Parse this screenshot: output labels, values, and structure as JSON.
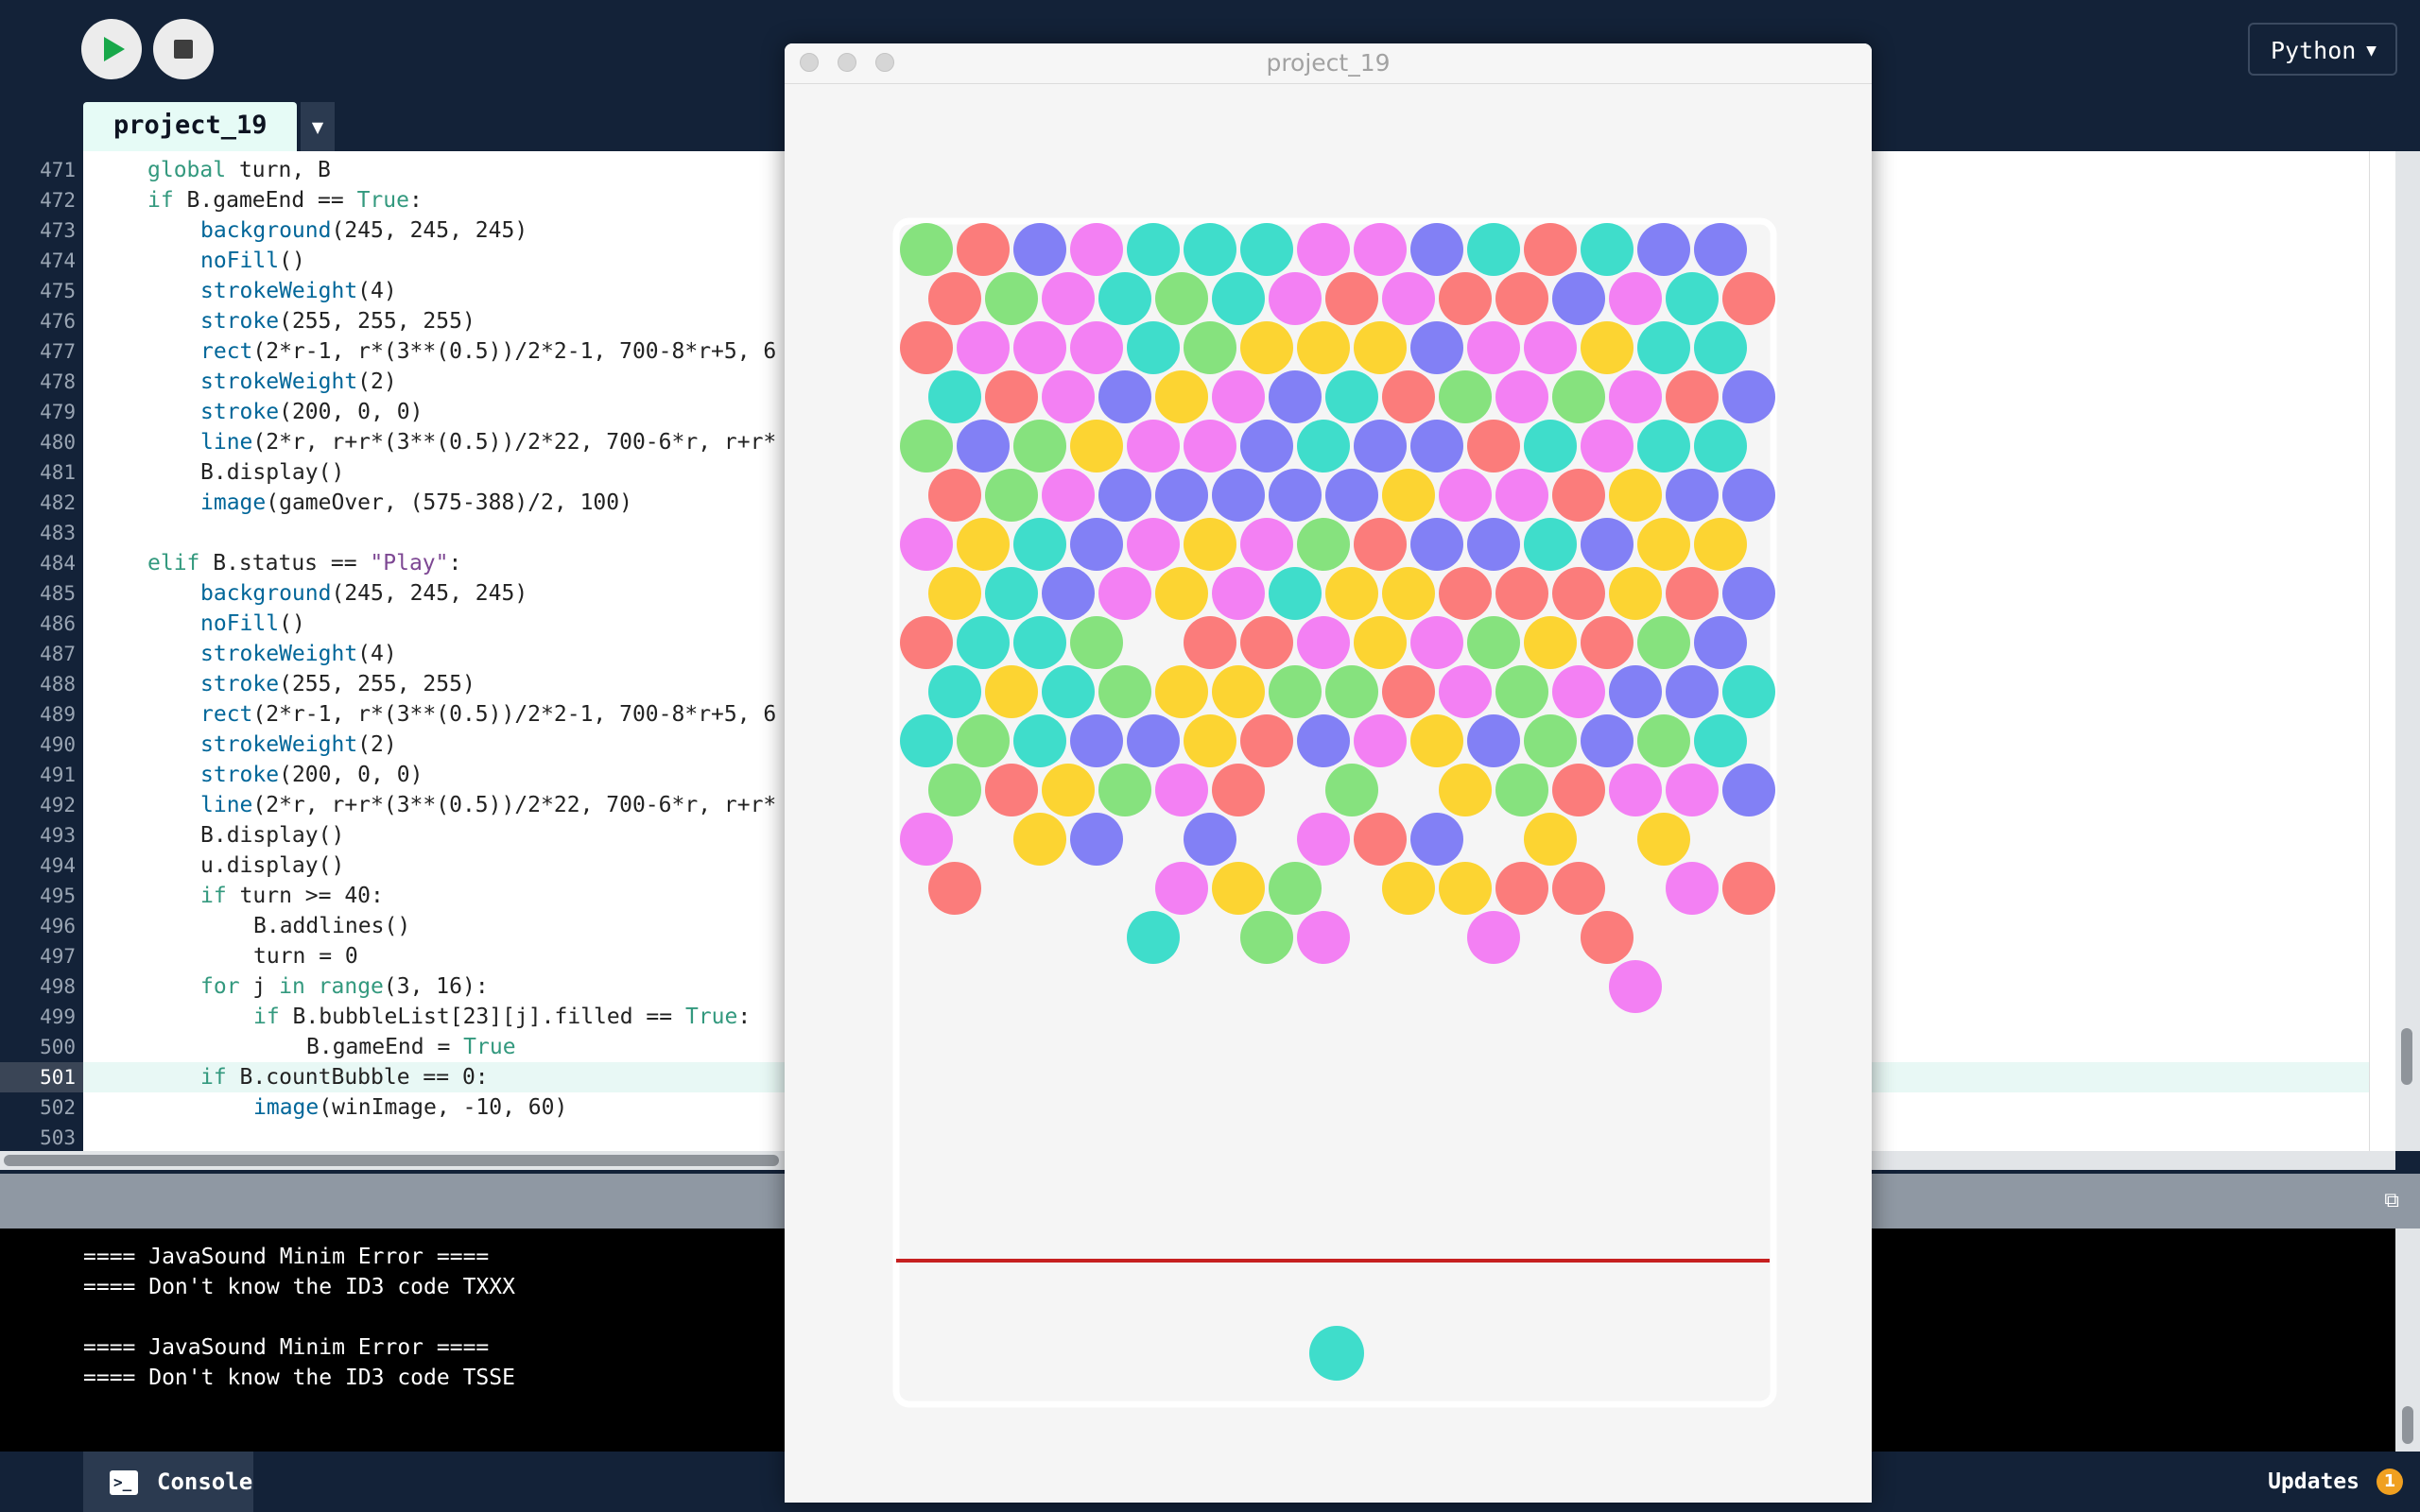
{
  "toolbar": {
    "run_icon": "play-icon",
    "stop_icon": "stop-icon",
    "mode": "Python",
    "mode_caret": "▼"
  },
  "tab": {
    "label": "project_19",
    "menu_caret": "▼"
  },
  "editor": {
    "current_line": "501",
    "lines": [
      {
        "num": "471",
        "indent": 1,
        "tokens": [
          {
            "t": "kw",
            "v": "global"
          },
          {
            "t": "",
            "v": " turn, B"
          }
        ]
      },
      {
        "num": "472",
        "indent": 1,
        "tokens": [
          {
            "t": "kw",
            "v": "if"
          },
          {
            "t": "",
            "v": " B.gameEnd == "
          },
          {
            "t": "kw",
            "v": "True"
          },
          {
            "t": "",
            "v": ":"
          }
        ]
      },
      {
        "num": "473",
        "indent": 2,
        "tokens": [
          {
            "t": "fn",
            "v": "background"
          },
          {
            "t": "",
            "v": "(245, 245, 245)"
          }
        ]
      },
      {
        "num": "474",
        "indent": 2,
        "tokens": [
          {
            "t": "fn",
            "v": "noFill"
          },
          {
            "t": "",
            "v": "()"
          }
        ]
      },
      {
        "num": "475",
        "indent": 2,
        "tokens": [
          {
            "t": "fn",
            "v": "strokeWeight"
          },
          {
            "t": "",
            "v": "(4)"
          }
        ]
      },
      {
        "num": "476",
        "indent": 2,
        "tokens": [
          {
            "t": "fn",
            "v": "stroke"
          },
          {
            "t": "",
            "v": "(255, 255, 255)"
          }
        ]
      },
      {
        "num": "477",
        "indent": 2,
        "tokens": [
          {
            "t": "fn",
            "v": "rect"
          },
          {
            "t": "",
            "v": "(2*r-1, r*(3**(0.5))/2*2-1, 700-8*r+5, 6"
          }
        ]
      },
      {
        "num": "478",
        "indent": 2,
        "tokens": [
          {
            "t": "fn",
            "v": "strokeWeight"
          },
          {
            "t": "",
            "v": "(2)"
          }
        ]
      },
      {
        "num": "479",
        "indent": 2,
        "tokens": [
          {
            "t": "fn",
            "v": "stroke"
          },
          {
            "t": "",
            "v": "(200, 0, 0)"
          }
        ]
      },
      {
        "num": "480",
        "indent": 2,
        "tokens": [
          {
            "t": "fn",
            "v": "line"
          },
          {
            "t": "",
            "v": "(2*r, r+r*(3**(0.5))/2*22, 700-6*r, r+r*"
          }
        ]
      },
      {
        "num": "481",
        "indent": 2,
        "tokens": [
          {
            "t": "",
            "v": "B.display()"
          }
        ]
      },
      {
        "num": "482",
        "indent": 2,
        "tokens": [
          {
            "t": "fn",
            "v": "image"
          },
          {
            "t": "",
            "v": "(gameOver, (575-388)/2, 100)"
          }
        ]
      },
      {
        "num": "483",
        "indent": 0,
        "tokens": []
      },
      {
        "num": "484",
        "indent": 1,
        "tokens": [
          {
            "t": "kw",
            "v": "elif"
          },
          {
            "t": "",
            "v": " B.status == "
          },
          {
            "t": "str",
            "v": "\"Play\""
          },
          {
            "t": "",
            "v": ":"
          }
        ]
      },
      {
        "num": "485",
        "indent": 2,
        "tokens": [
          {
            "t": "fn",
            "v": "background"
          },
          {
            "t": "",
            "v": "(245, 245, 245)"
          }
        ]
      },
      {
        "num": "486",
        "indent": 2,
        "tokens": [
          {
            "t": "fn",
            "v": "noFill"
          },
          {
            "t": "",
            "v": "()"
          }
        ]
      },
      {
        "num": "487",
        "indent": 2,
        "tokens": [
          {
            "t": "fn",
            "v": "strokeWeight"
          },
          {
            "t": "",
            "v": "(4)"
          }
        ]
      },
      {
        "num": "488",
        "indent": 2,
        "tokens": [
          {
            "t": "fn",
            "v": "stroke"
          },
          {
            "t": "",
            "v": "(255, 255, 255)"
          }
        ]
      },
      {
        "num": "489",
        "indent": 2,
        "tokens": [
          {
            "t": "fn",
            "v": "rect"
          },
          {
            "t": "",
            "v": "(2*r-1, r*(3**(0.5))/2*2-1, 700-8*r+5, 6"
          }
        ]
      },
      {
        "num": "490",
        "indent": 2,
        "tokens": [
          {
            "t": "fn",
            "v": "strokeWeight"
          },
          {
            "t": "",
            "v": "(2)"
          }
        ]
      },
      {
        "num": "491",
        "indent": 2,
        "tokens": [
          {
            "t": "fn",
            "v": "stroke"
          },
          {
            "t": "",
            "v": "(200, 0, 0)"
          }
        ]
      },
      {
        "num": "492",
        "indent": 2,
        "tokens": [
          {
            "t": "fn",
            "v": "line"
          },
          {
            "t": "",
            "v": "(2*r, r+r*(3**(0.5))/2*22, 700-6*r, r+r*"
          }
        ]
      },
      {
        "num": "493",
        "indent": 2,
        "tokens": [
          {
            "t": "",
            "v": "B.display()"
          }
        ]
      },
      {
        "num": "494",
        "indent": 2,
        "tokens": [
          {
            "t": "",
            "v": "u.display()"
          }
        ]
      },
      {
        "num": "495",
        "indent": 2,
        "tokens": [
          {
            "t": "kw",
            "v": "if"
          },
          {
            "t": "",
            "v": " turn >= 40:"
          }
        ]
      },
      {
        "num": "496",
        "indent": 3,
        "tokens": [
          {
            "t": "",
            "v": "B.addlines()"
          }
        ]
      },
      {
        "num": "497",
        "indent": 3,
        "tokens": [
          {
            "t": "",
            "v": "turn = 0"
          }
        ]
      },
      {
        "num": "498",
        "indent": 2,
        "tokens": [
          {
            "t": "kw",
            "v": "for"
          },
          {
            "t": "",
            "v": " j "
          },
          {
            "t": "kw",
            "v": "in"
          },
          {
            "t": "",
            "v": " "
          },
          {
            "t": "kw",
            "v": "range"
          },
          {
            "t": "",
            "v": "(3, 16):"
          }
        ]
      },
      {
        "num": "499",
        "indent": 3,
        "tokens": [
          {
            "t": "kw",
            "v": "if"
          },
          {
            "t": "",
            "v": " B.bubbleList[23][j].filled == "
          },
          {
            "t": "kw",
            "v": "True"
          },
          {
            "t": "",
            "v": ":"
          }
        ]
      },
      {
        "num": "500",
        "indent": 4,
        "tokens": [
          {
            "t": "",
            "v": "B.gameEnd = "
          },
          {
            "t": "kw",
            "v": "True"
          }
        ]
      },
      {
        "num": "501",
        "indent": 2,
        "tokens": [
          {
            "t": "kw",
            "v": "if"
          },
          {
            "t": "",
            "v": " B.countBubble == 0:"
          }
        ]
      },
      {
        "num": "502",
        "indent": 3,
        "tokens": [
          {
            "t": "fn",
            "v": "image"
          },
          {
            "t": "",
            "v": "(winImage, -10, 60)"
          }
        ]
      },
      {
        "num": "503",
        "indent": 0,
        "tokens": []
      }
    ]
  },
  "console": {
    "lines": [
      "==== JavaSound Minim Error ====",
      "==== Don't know the ID3 code TXXX",
      "",
      "==== JavaSound Minim Error ====",
      "==== Don't know the ID3 code TSSE"
    ],
    "tab_label": "Console",
    "tab_icon": "terminal-icon"
  },
  "status": {
    "updates_label": "Updates",
    "updates_count": "1"
  },
  "sketch_window": {
    "title": "project_19",
    "game": {
      "colors": {
        "G": "#86e27e",
        "R": "#fb7c7b",
        "B": "#8280f5",
        "P": "#f380f3",
        "T": "#3fddcb",
        "Y": "#fcd432"
      },
      "rows": [
        "GRBPTTTPPBTRTBB",
        "RGPTGTPRPRRBPTR",
        "RPPPTGYYYBPPYTT",
        "TRPBYPBTRGPGPRB",
        "GBGYPPBTBBRTPTT",
        "RGPBBBBBYPPRYBB",
        "PYTBPYPGRBBTBYY",
        "YTBPYPTYYRRRYRB",
        "RTTG.RRPYPGYRGB",
        "TYTGYYGGRPGPBBT",
        "TGTBBYRBPYBGBGT",
        "GRYGPR.G.YGRPPB",
        "P.YB.B.PRB.Y.Y.",
        "R...PYG.YYRR.PR",
        "....T.GP..P.R..",
        "............P.."
      ],
      "shooter_color": "T",
      "limit_line_color": "#c62020",
      "background": "#f5f5f5"
    }
  }
}
